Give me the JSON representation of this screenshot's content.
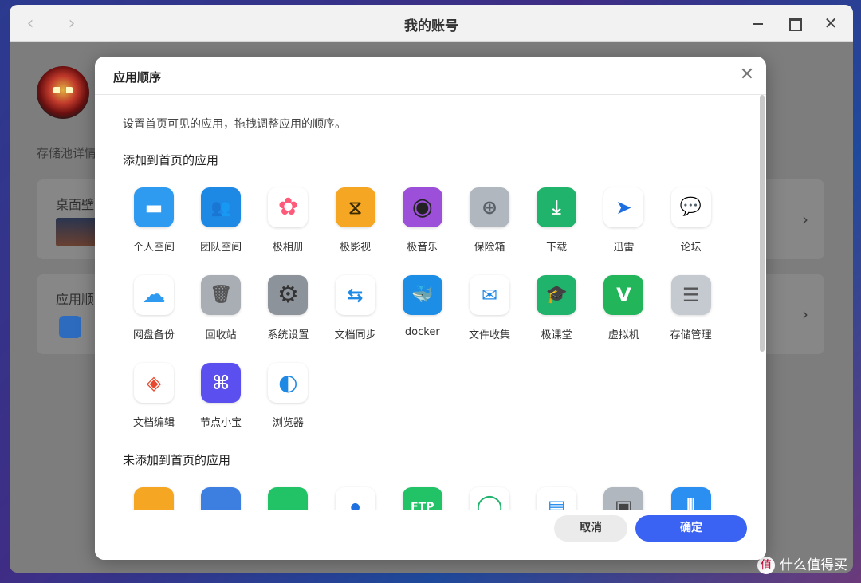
{
  "window": {
    "title": "我的账号",
    "back_icon": "‹",
    "forward_icon": "›",
    "close_icon": "✕"
  },
  "background": {
    "section_label": "存储池详情",
    "card1_title": "桌面壁",
    "card2_title": "应用顺",
    "chevron": "›"
  },
  "watermark": {
    "icon_text": "值",
    "text": "什么值得买"
  },
  "dialog": {
    "title": "应用顺序",
    "close_icon": "✕",
    "description": "设置首页可见的应用，拖拽调整应用的顺序。",
    "added_section_title": "添加到首页的应用",
    "not_added_section_title": "未添加到首页的应用",
    "cancel_label": "取消",
    "ok_label": "确定"
  },
  "added_apps": [
    {
      "label": "个人空间",
      "icon": "folder-icon",
      "color": "#2e9bf0"
    },
    {
      "label": "团队空间",
      "icon": "team-folder-icon",
      "color": "#1e88e5"
    },
    {
      "label": "极相册",
      "icon": "photos-flower-icon",
      "color": "#ffffff"
    },
    {
      "label": "极影视",
      "icon": "film-icon",
      "color": "#f5a623"
    },
    {
      "label": "极音乐",
      "icon": "music-disc-icon",
      "color": "#9c4fd8"
    },
    {
      "label": "保险箱",
      "icon": "safe-icon",
      "color": "#b0b7bf"
    },
    {
      "label": "下载",
      "icon": "download-icon",
      "color": "#1fb36b"
    },
    {
      "label": "迅雷",
      "icon": "thunder-bird-icon",
      "color": "#ffffff"
    },
    {
      "label": "论坛",
      "icon": "chat-bubbles-icon",
      "color": "#ffffff"
    },
    {
      "label": "网盘备份",
      "icon": "cloud-download-icon",
      "color": "#ffffff"
    },
    {
      "label": "回收站",
      "icon": "trash-icon",
      "color": "#a9aeb5"
    },
    {
      "label": "系统设置",
      "icon": "gear-icon",
      "color": "#8d939b"
    },
    {
      "label": "文档同步",
      "icon": "sync-arrows-icon",
      "color": "#ffffff"
    },
    {
      "label": "docker",
      "icon": "docker-whale-icon",
      "color": "#1d8ee6"
    },
    {
      "label": "文件收集",
      "icon": "inbox-icon",
      "color": "#ffffff"
    },
    {
      "label": "极课堂",
      "icon": "graduation-cap-icon",
      "color": "#1fb36b"
    },
    {
      "label": "虚拟机",
      "icon": "vm-v-icon",
      "color": "#22b55a"
    },
    {
      "label": "存储管理",
      "icon": "storage-server-icon",
      "color": "#c5cad0"
    },
    {
      "label": "文档编辑",
      "icon": "layers-icon",
      "color": "#ffffff"
    },
    {
      "label": "节点小宝",
      "icon": "node-knot-icon",
      "color": "#5b4ff0"
    },
    {
      "label": "浏览器",
      "icon": "browser-icon",
      "color": "#ffffff"
    }
  ],
  "not_added_apps": [
    {
      "icon": "orange-app-icon",
      "color": "#f5a623"
    },
    {
      "icon": "blueprint-app-icon",
      "color": "#3d7fe0"
    },
    {
      "icon": "green-app-icon",
      "color": "#22c266"
    },
    {
      "icon": "person-app-icon",
      "color": "#ffffff"
    },
    {
      "icon": "ftp-icon",
      "color": "#22c266"
    },
    {
      "icon": "green-circle-app-icon",
      "color": "#ffffff"
    },
    {
      "icon": "blue-stack-app-icon",
      "color": "#ffffff"
    },
    {
      "icon": "gray-device-app-icon",
      "color": "#b0b7bf"
    },
    {
      "icon": "audio-wave-app-icon",
      "color": "#2a8ff0"
    }
  ]
}
